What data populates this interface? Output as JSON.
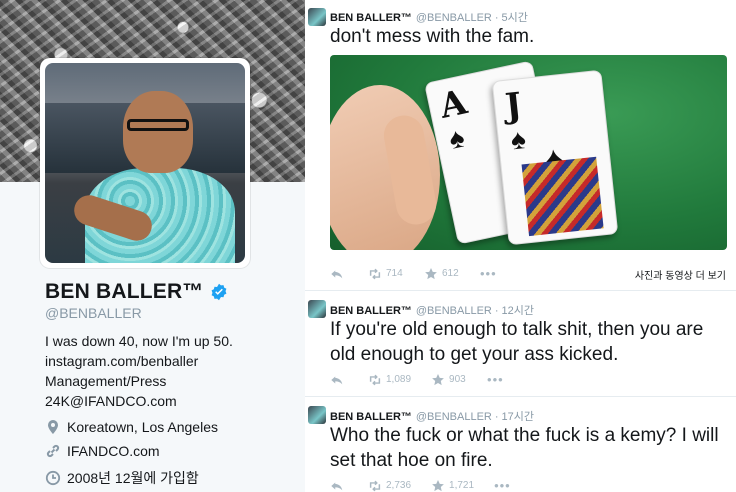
{
  "profile": {
    "name": "BEN BALLER™",
    "handle": "@BENBALLER",
    "bio": [
      "I was down 40, now I'm up 50.",
      "instagram.com/benballer",
      "Management/Press",
      "24K@IFANDCO.com"
    ],
    "location": "Koreatown, Los Angeles",
    "website": "IFANDCO.com",
    "joined": "2008년 12월에 가입함",
    "icons": {
      "verified": "verified-badge-icon",
      "location": "location-pin-icon",
      "link": "link-icon",
      "joined": "calendar-clock-icon"
    },
    "colors": {
      "verified": "#1da1f2",
      "text": "#14171a",
      "muted": "#8899a6"
    }
  },
  "tweets": [
    {
      "name": "BEN BALLER™",
      "handle": "@BENBALLER",
      "time": "5시간",
      "text": "don't mess with the fam.",
      "retweets": "714",
      "likes": "612",
      "more": "•••",
      "media_link": "사진과 동영상 더 보기",
      "has_photo": true,
      "photo_card_ranks": [
        "A",
        "J"
      ]
    },
    {
      "name": "BEN BALLER™",
      "handle": "@BENBALLER",
      "time": "12시간",
      "text": "If you're old enough to talk shit, then you are old enough to get your ass kicked.",
      "retweets": "1,089",
      "likes": "903",
      "more": "•••"
    },
    {
      "name": "BEN BALLER™",
      "handle": "@BENBALLER",
      "time": "17시간",
      "text": "Who the fuck or what the fuck is a kemy? I will set that hoe on fire.",
      "retweets": "2,736",
      "likes": "1,721",
      "more": "•••"
    }
  ]
}
